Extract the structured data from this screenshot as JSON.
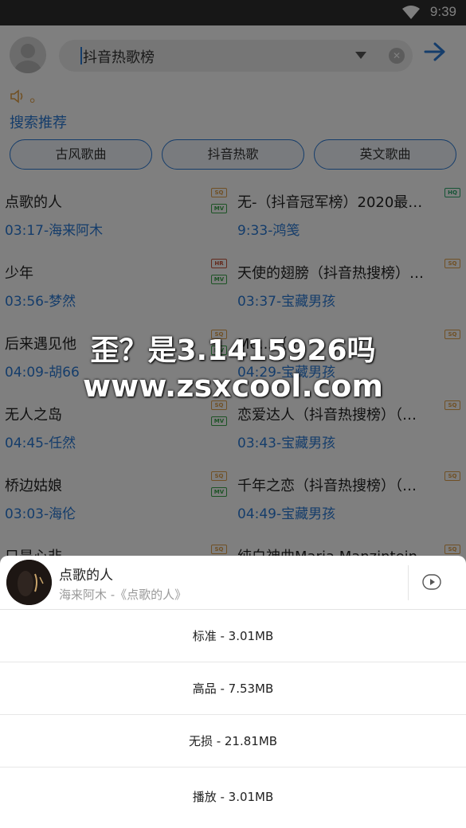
{
  "status": {
    "time": "9:39"
  },
  "search": {
    "query": "抖音热歌榜",
    "clear": "✕"
  },
  "notice": {
    "text": "。"
  },
  "recommend": {
    "title": "搜索推荐",
    "chips": [
      "古风歌曲",
      "抖音热歌",
      "英文歌曲"
    ]
  },
  "songs": [
    {
      "title": "点歌的人",
      "time": "03:17",
      "artist": "海来阿木",
      "badges": [
        "SQ",
        "MV"
      ]
    },
    {
      "title": "无-（抖音冠军榜）2020最…",
      "time": "9:33",
      "artist": "鸿笺",
      "badges": [
        "HQ"
      ]
    },
    {
      "title": "少年",
      "time": "03:56",
      "artist": "梦然",
      "badges": [
        "HR",
        "MV"
      ]
    },
    {
      "title": "天使的翅膀（抖音热搜榜）…",
      "time": "03:37",
      "artist": "宝藏男孩",
      "badges": [
        "SQ"
      ]
    },
    {
      "title": "后来遇见他",
      "time": "04:09",
      "artist": "胡66",
      "badges": [
        "SQ",
        "MV"
      ]
    },
    {
      "title": "Mo…（…",
      "time": "04:29",
      "artist": "宝藏男孩",
      "badges": [
        "SQ"
      ]
    },
    {
      "title": "无人之岛",
      "time": "04:45",
      "artist": "任然",
      "badges": [
        "SQ",
        "MV"
      ]
    },
    {
      "title": "恋爱达人（抖音热搜榜）（…",
      "time": "03:43",
      "artist": "宝藏男孩",
      "badges": [
        "SQ"
      ]
    },
    {
      "title": "桥边姑娘",
      "time": "03:03",
      "artist": "海伦",
      "badges": [
        "SQ",
        "MV"
      ]
    },
    {
      "title": "千年之恋（抖音热搜榜）（…",
      "time": "04:49",
      "artist": "宝藏男孩",
      "badges": [
        "SQ"
      ]
    },
    {
      "title": "只是心非",
      "time": "",
      "artist": "",
      "badges": [
        "SQ"
      ]
    },
    {
      "title": "纯白神曲Maria Manzintein…",
      "time": "",
      "artist": "",
      "badges": [
        "SQ"
      ]
    }
  ],
  "watermark": {
    "line1": "歪？是3.1415926吗",
    "line2": "www.zsxcool.com"
  },
  "sheet": {
    "title": "点歌的人",
    "subtitle": "海来阿木 -《点歌的人》",
    "options": [
      "标准 - 3.01MB",
      "高品 - 7.53MB",
      "无损 - 21.81MB",
      "播放 - 3.01MB"
    ]
  },
  "icons": {
    "status": [
      "wifi-icon"
    ],
    "search": [
      "avatar-icon",
      "dropdown-icon",
      "clear-icon",
      "go-arrow-icon"
    ],
    "notice": [
      "speaker-icon"
    ],
    "sheet": [
      "album-cover",
      "play-circle-icon"
    ]
  },
  "colors": {
    "accent": "#2a7ad6",
    "overlay": "rgba(0,0,0,0.5)"
  }
}
